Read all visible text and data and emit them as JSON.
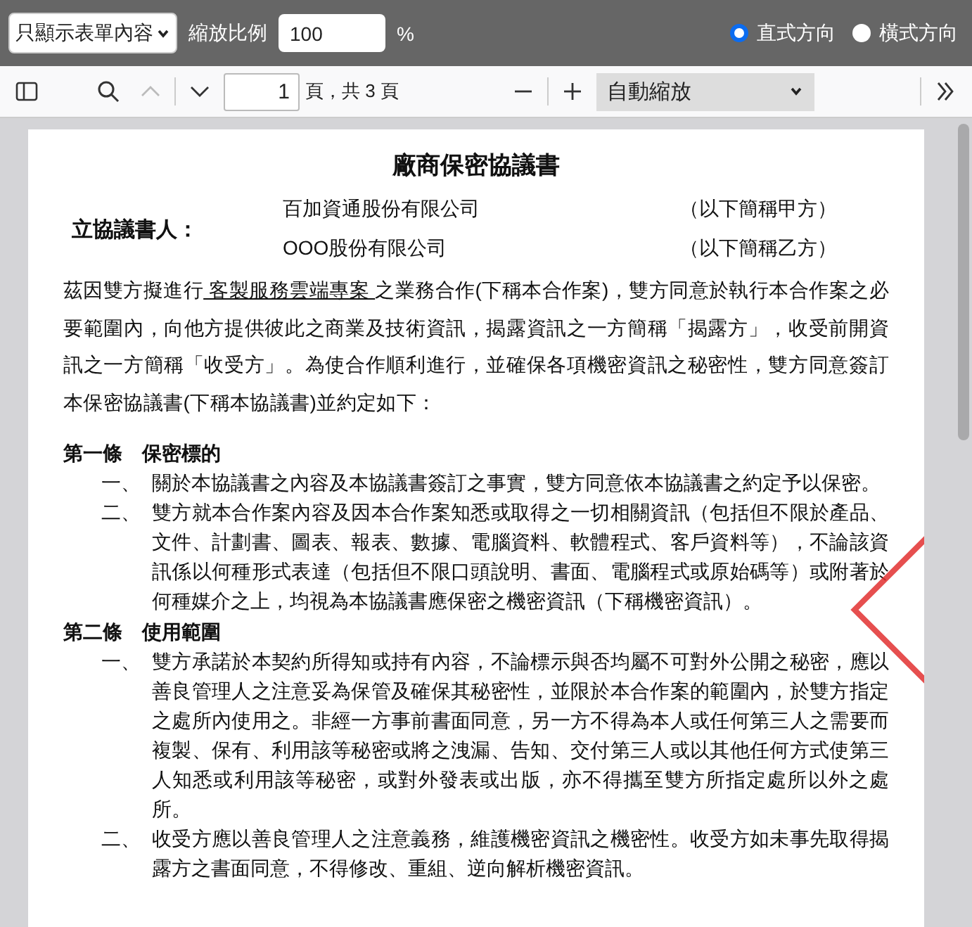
{
  "form_toolbar": {
    "view_select": "只顯示表單內容",
    "zoom_label": "縮放比例",
    "zoom_value": "100",
    "percent": "%",
    "orientation": [
      {
        "label": "直式方向",
        "selected": true
      },
      {
        "label": "橫式方向",
        "selected": false
      }
    ]
  },
  "viewer_toolbar": {
    "page_number": "1",
    "page_count": "頁，共 3 頁",
    "zoom_select": "自動縮放"
  },
  "document": {
    "title": "廠商保密協議書",
    "parties_label": "立協議書人：",
    "parties": [
      {
        "name": "百加資通股份有限公司",
        "alias": "（以下簡稱甲方）"
      },
      {
        "name": "OOO股份有限公司",
        "alias": "（以下簡稱乙方）"
      }
    ],
    "intro": [
      {
        "text": "茲因雙方擬進行",
        "underlined": false
      },
      {
        "text": " 客製服務雲端專案 ",
        "underlined": true
      },
      {
        "text": "之業務合作(下稱本合作案)，雙方同意於執行本合作案之必要範圍內，向他方提供彼此之商業及技術資訊，揭露資訊之一方簡稱「揭露方」，收受前開資訊之一方簡稱「收受方」。為使合作順利進行，並確保各項機密資訊之秘密性，雙方同意簽訂本保密協議書(下稱本協議書)並約定如下：",
        "underlined": false
      }
    ],
    "articles": [
      {
        "heading": "第一條　保密標的",
        "items": [
          {
            "number": "一、",
            "text": "關於本協議書之內容及本協議書簽訂之事實，雙方同意依本協議書之約定予以保密。"
          },
          {
            "number": "二、",
            "text": "雙方就本合作案內容及因本合作案知悉或取得之一切相關資訊（包括但不限於產品、文件、計劃書、圖表、報表、數據、電腦資料、軟體程式、客戶資料等），不論該資訊係以何種形式表達（包括但不限口頭說明、書面、電腦程式或原始碼等）或附著於何種媒介之上，均視為本協議書應保密之機密資訊（下稱機密資訊）。"
          }
        ]
      },
      {
        "heading": "第二條　使用範圍",
        "items": [
          {
            "number": "一、",
            "text": "雙方承諾於本契約所得知或持有內容，不論標示與否均屬不可對外公開之秘密，應以善良管理人之注意妥為保管及確保其秘密性，並限於本合作案的範圍內，於雙方指定之處所內使用之。非經一方事前書面同意，另一方不得為本人或任何第三人之需要而複製、保有、利用該等秘密或將之洩漏、告知、交付第三人或以其他任何方式使第三人知悉或利用該等秘密，或對外發表或出版，亦不得攜至雙方所指定處所以外之處所。"
          },
          {
            "number": "二、",
            "text": "收受方應以善良管理人之注意義務，維護機密資訊之機密性。收受方如未事先取得揭露方之書面同意，不得修改、重組、逆向解析機密資訊。"
          }
        ]
      }
    ]
  }
}
